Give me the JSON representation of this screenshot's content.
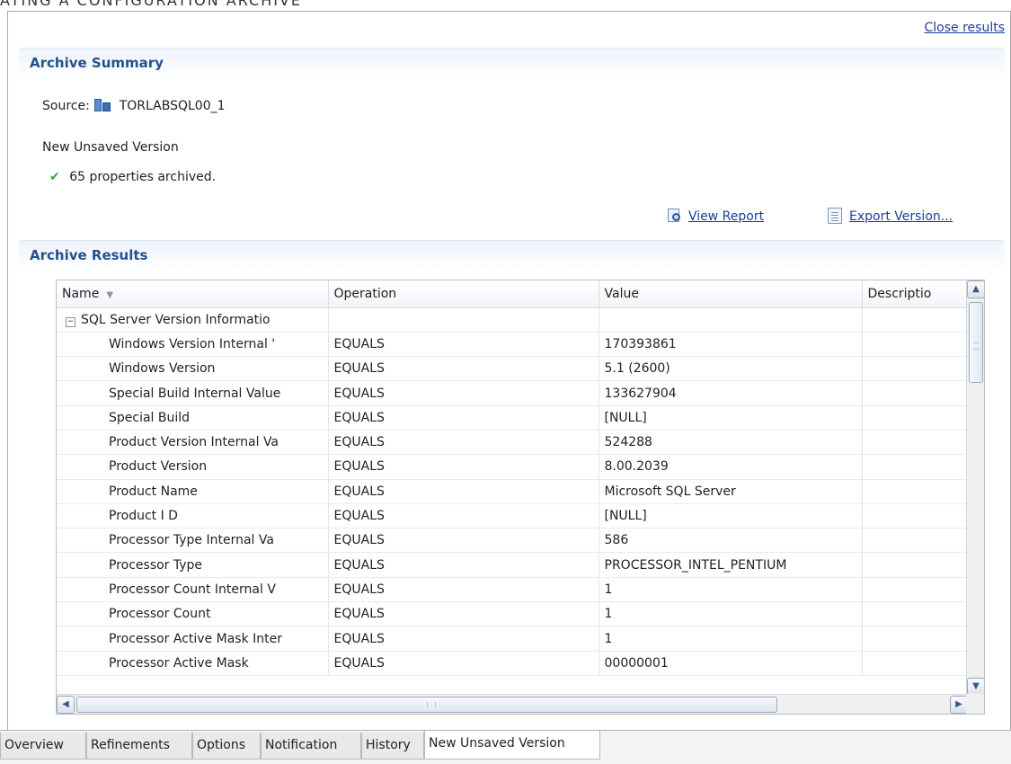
{
  "page_heading": "ATING A CONFIGURATION ARCHIVE",
  "close_results": "Close results",
  "summary": {
    "title": "Archive Summary",
    "source_label": "Source:",
    "source_value": "TORLABSQL00_1",
    "version": "New Unsaved Version",
    "archived_text": "65 properties archived.",
    "view_report": "View Report",
    "export_version": "Export Version..."
  },
  "results": {
    "title": "Archive Results",
    "columns": [
      "Name",
      "Operation",
      "Value",
      "Descriptio"
    ],
    "group": "SQL Server Version Informatio",
    "rows": [
      {
        "name": "Windows Version Internal '",
        "op": "EQUALS",
        "value": "170393861"
      },
      {
        "name": "Windows Version",
        "op": "EQUALS",
        "value": "5.1 (2600)"
      },
      {
        "name": "Special Build Internal Value",
        "op": "EQUALS",
        "value": "133627904"
      },
      {
        "name": "Special Build",
        "op": "EQUALS",
        "value": "[NULL]"
      },
      {
        "name": "Product Version Internal Va",
        "op": "EQUALS",
        "value": "524288"
      },
      {
        "name": "Product Version",
        "op": "EQUALS",
        "value": "8.00.2039"
      },
      {
        "name": "Product Name",
        "op": "EQUALS",
        "value": "Microsoft SQL Server"
      },
      {
        "name": "Product I D",
        "op": "EQUALS",
        "value": "[NULL]"
      },
      {
        "name": "Processor Type Internal Va",
        "op": "EQUALS",
        "value": "586"
      },
      {
        "name": "Processor Type",
        "op": "EQUALS",
        "value": "PROCESSOR_INTEL_PENTIUM"
      },
      {
        "name": "Processor Count Internal V",
        "op": "EQUALS",
        "value": "1"
      },
      {
        "name": "Processor Count",
        "op": "EQUALS",
        "value": "1"
      },
      {
        "name": "Processor Active Mask Inter",
        "op": "EQUALS",
        "value": "1"
      },
      {
        "name": "Processor Active Mask",
        "op": "EQUALS",
        "value": "00000001"
      }
    ]
  },
  "tabs": [
    "Overview",
    "Refinements",
    "Options",
    "Notification",
    "History",
    "New Unsaved Version"
  ],
  "active_tab": "New Unsaved Version",
  "colors": {
    "link": "#1a3f9c",
    "section_title": "#24508f",
    "check": "#3aa43a"
  }
}
